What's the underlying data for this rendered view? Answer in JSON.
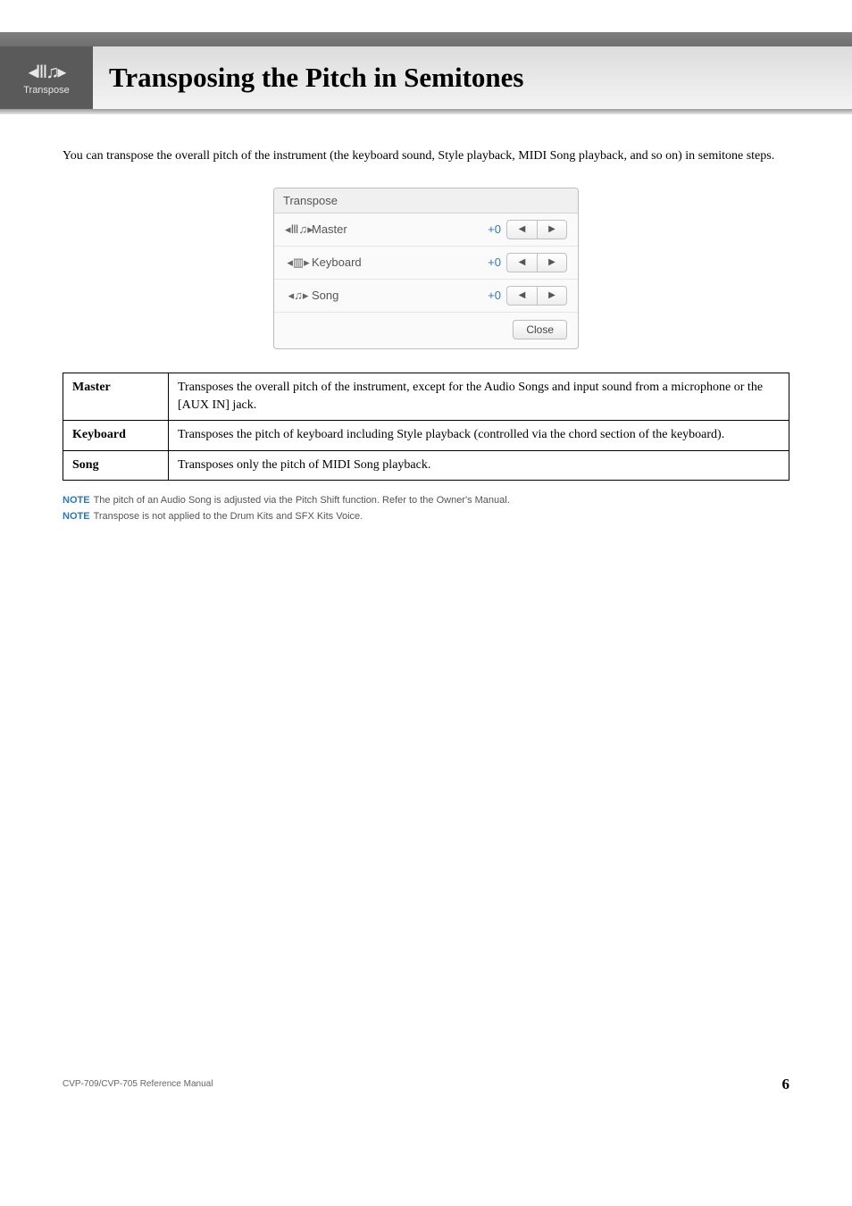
{
  "header": {
    "badge_label": "Transpose",
    "title": "Transposing the Pitch in Semitones"
  },
  "intro": "You can transpose the overall pitch of the instrument (the keyboard sound, Style playback, MIDI Song playback, and so on) in semitone steps.",
  "panel": {
    "title": "Transpose",
    "rows": {
      "master": {
        "label": "Master",
        "value": "+0"
      },
      "keyboard": {
        "label": "Keyboard",
        "value": "+0"
      },
      "song": {
        "label": "Song",
        "value": "+0"
      }
    },
    "close": "Close"
  },
  "table": {
    "master": {
      "head": "Master",
      "body": "Transposes the overall pitch of the instrument, except for the Audio Songs and input sound from a microphone or the [AUX IN] jack."
    },
    "keyboard": {
      "head": "Keyboard",
      "body": "Transposes the pitch of keyboard including Style playback (controlled via the chord section of the keyboard)."
    },
    "song": {
      "head": "Song",
      "body": "Transposes only the pitch of MIDI Song playback."
    }
  },
  "notes": {
    "label": "NOTE",
    "n1": "The pitch of an Audio Song is adjusted via the Pitch Shift function. Refer to the Owner's Manual.",
    "n2": "Transpose is not applied to the Drum Kits and SFX Kits Voice."
  },
  "footer": {
    "ref": "CVP-709/CVP-705 Reference Manual",
    "page": "6"
  }
}
